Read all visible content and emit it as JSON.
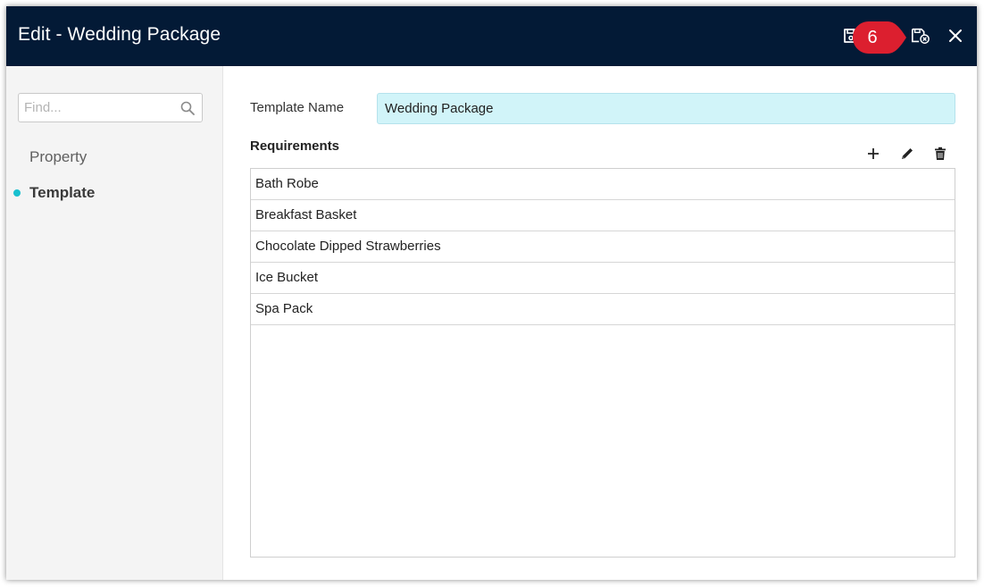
{
  "dialog": {
    "title": "Edit - Wedding Package",
    "step_marker": "6",
    "colors": {
      "header": "#031a36",
      "accent": "#17c0cf",
      "marker": "#dc1f2f",
      "input_fill": "#d1f4f9"
    }
  },
  "toolbar": {
    "icons": [
      "save-icon",
      "save-and-close-icon",
      "close-icon"
    ]
  },
  "sidebar": {
    "search": {
      "placeholder": "Find...",
      "value": ""
    },
    "items": [
      {
        "label": "Property",
        "active": false
      },
      {
        "label": "Template",
        "active": true
      }
    ]
  },
  "form": {
    "template_name_label": "Template Name",
    "template_name_value": "Wedding Package",
    "requirements_label": "Requirements",
    "requirements_tools": [
      "add-icon",
      "edit-icon",
      "delete-icon"
    ],
    "requirements": [
      "Bath Robe",
      "Breakfast Basket",
      "Chocolate Dipped Strawberries",
      "Ice Bucket",
      "Spa Pack"
    ]
  }
}
